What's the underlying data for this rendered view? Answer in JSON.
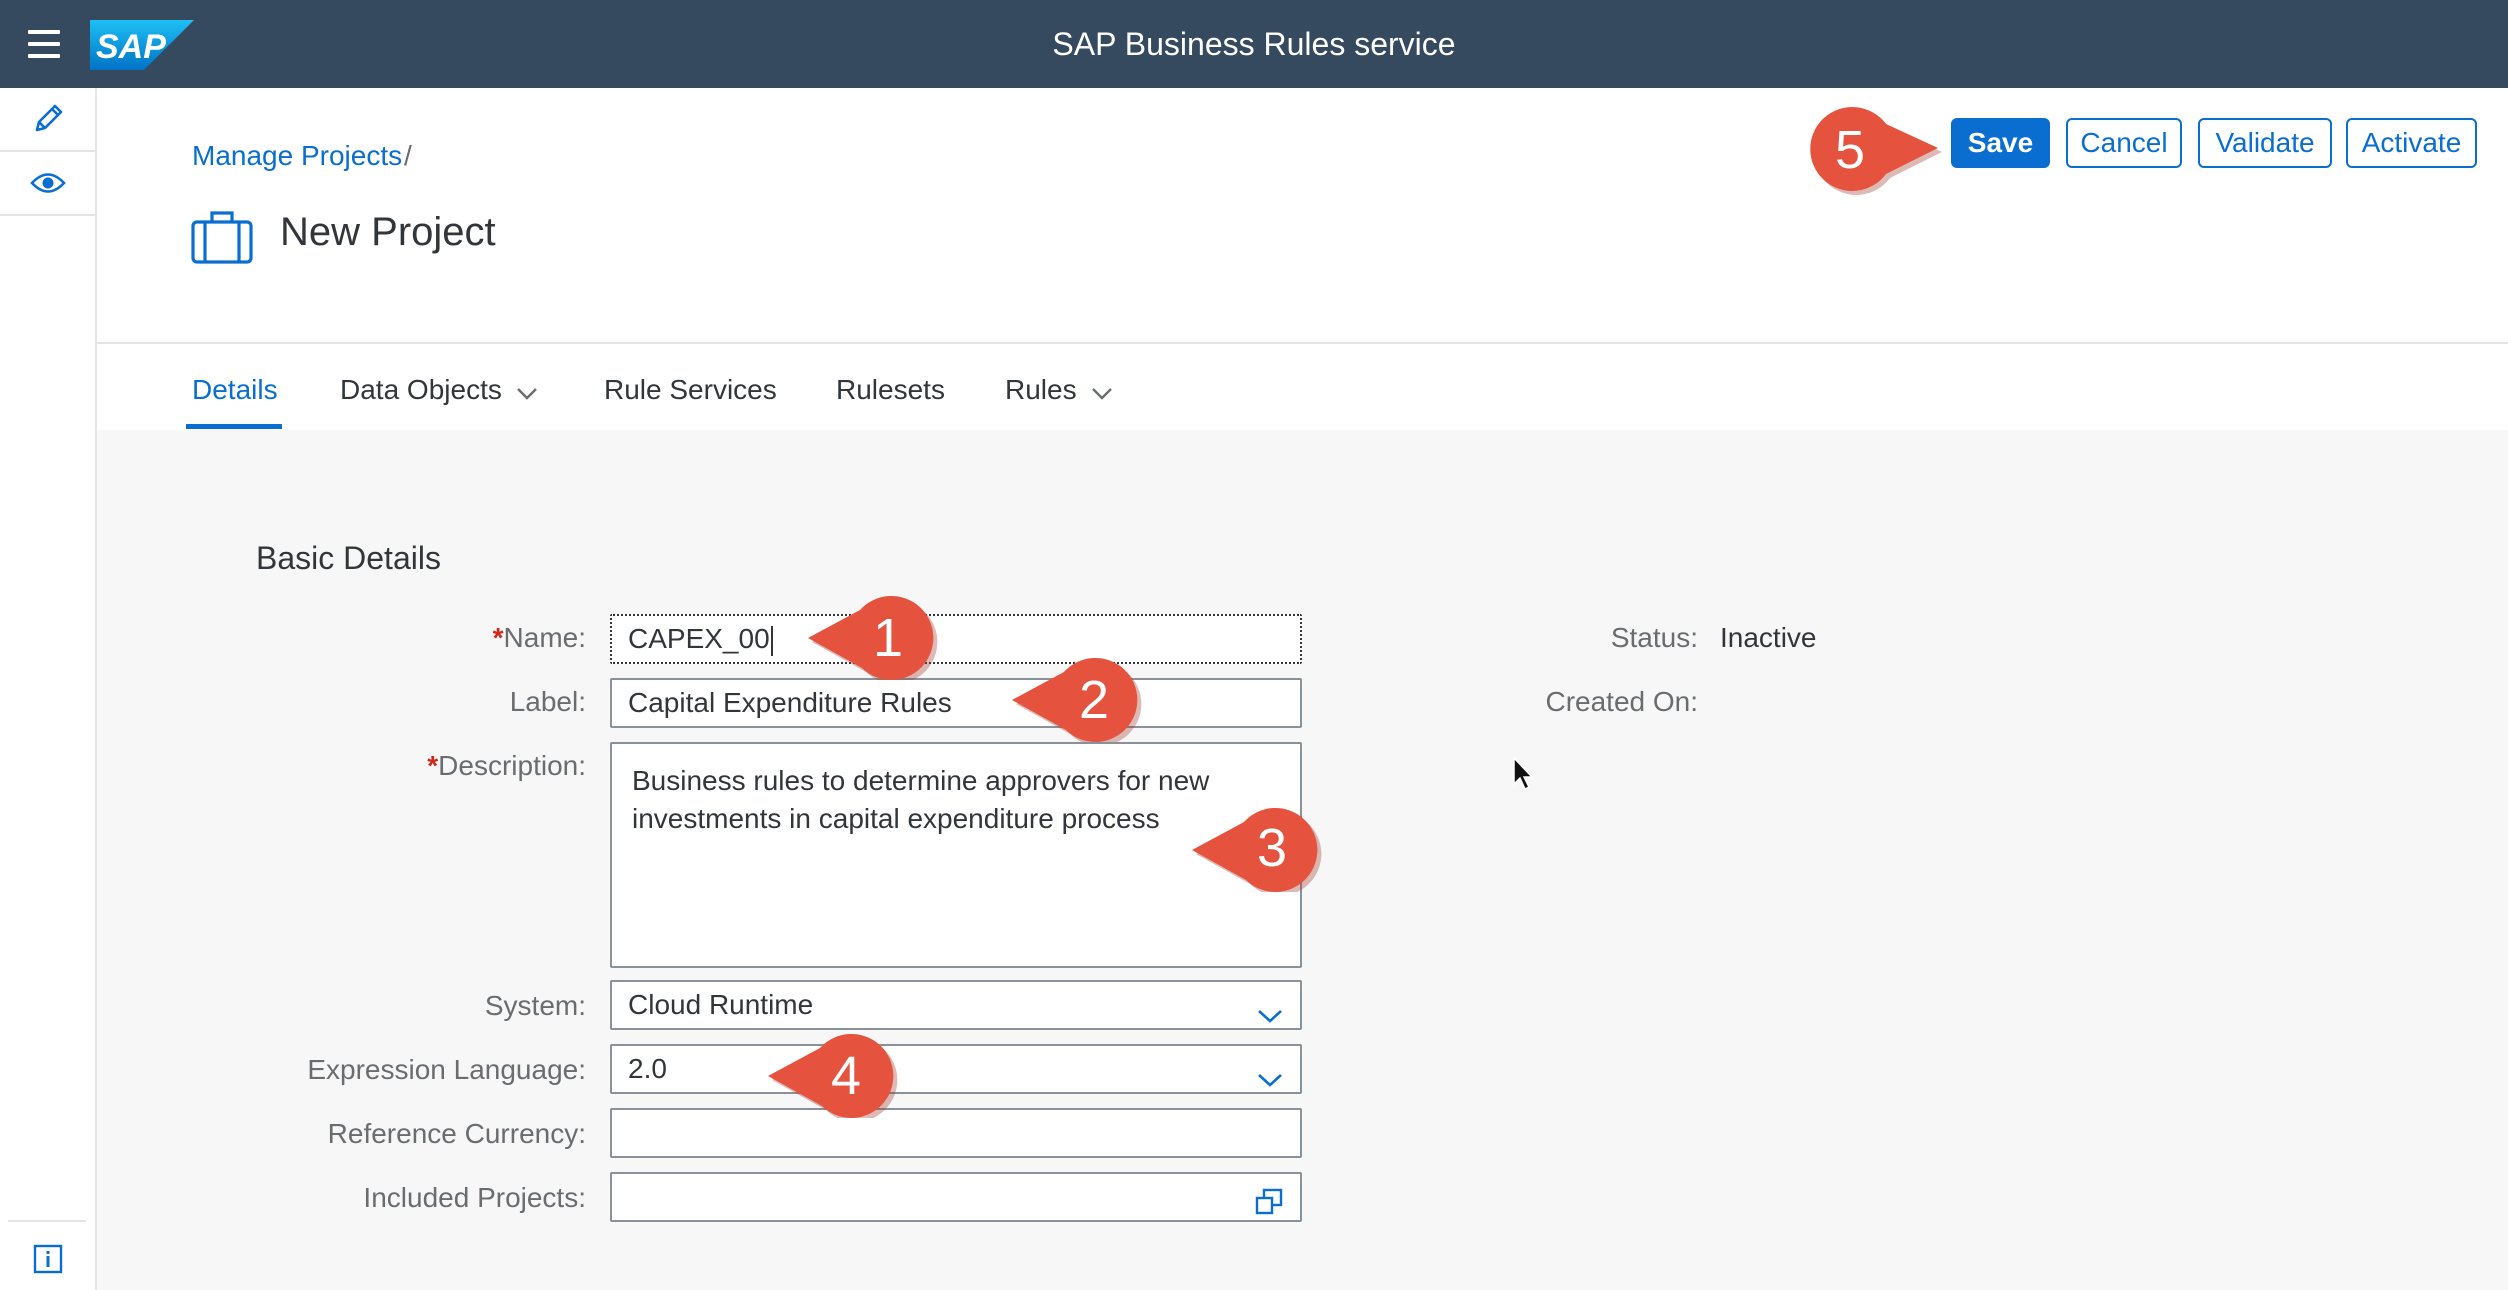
{
  "shell": {
    "title": "SAP Business Rules service",
    "logo_text": "SAP"
  },
  "header": {
    "breadcrumb": "Manage Projects",
    "breadcrumb_separator": "/",
    "title": "New Project",
    "buttons": {
      "save": "Save",
      "cancel": "Cancel",
      "validate": "Validate",
      "activate": "Activate"
    }
  },
  "tabs": [
    {
      "label": "Details",
      "selected": true
    },
    {
      "label": "Data Objects",
      "has_dropdown": true
    },
    {
      "label": "Rule Services"
    },
    {
      "label": "Rulesets"
    },
    {
      "label": "Rules",
      "has_dropdown": true
    }
  ],
  "form": {
    "section_title": "Basic Details",
    "required_marker": "*",
    "name": {
      "label": "Name:",
      "value": "CAPEX_00"
    },
    "label_field": {
      "label": "Label:",
      "value": "Capital Expenditure Rules"
    },
    "description": {
      "label": "Description:",
      "value": "Business rules to determine approvers for new investments in capital expenditure process"
    },
    "system": {
      "label": "System:",
      "value": "Cloud Runtime"
    },
    "expression_language": {
      "label": "Expression Language:",
      "value": "2.0"
    },
    "reference_currency": {
      "label": "Reference Currency:",
      "value": ""
    },
    "included_projects": {
      "label": "Included Projects:",
      "value": ""
    },
    "status": {
      "label": "Status:",
      "value": "Inactive"
    },
    "created_on": {
      "label": "Created On:",
      "value": ""
    }
  },
  "callouts": [
    "1",
    "2",
    "3",
    "4",
    "5"
  ],
  "colors": {
    "shell": "#354a5f",
    "accent": "#0a6ed1",
    "callout": "#e5533e",
    "required": "#d0271d"
  },
  "icons": {
    "menu": "hamburger-icon",
    "edit": "pencil-icon",
    "view": "eye-icon",
    "info": "info-icon",
    "project": "briefcase-icon",
    "dropdown": "chevron-down-icon",
    "value_help": "value-help-icon",
    "cursor": "mouse-pointer-icon"
  }
}
